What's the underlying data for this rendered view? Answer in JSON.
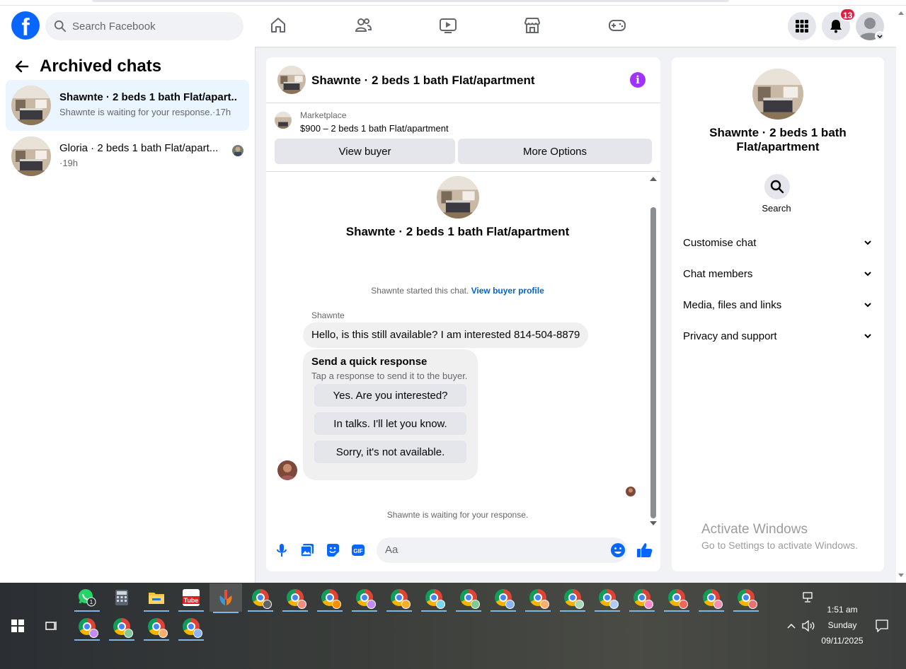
{
  "header": {
    "logo_letter": "f",
    "search_placeholder": "Search Facebook",
    "nav_icons": [
      "home-icon",
      "friends-icon",
      "video-icon",
      "marketplace-icon",
      "gaming-icon"
    ],
    "notification_count": "13"
  },
  "left": {
    "title": "Archived chats",
    "chats": [
      {
        "name": "Shawnte · 2 beds 1 bath Flat/apart...",
        "subtitle": "Shawnte is waiting for your response.·17h"
      },
      {
        "name": "Gloria · 2 beds 1 bath Flat/apart...",
        "subtitle": "·19h"
      }
    ]
  },
  "conversation": {
    "title": "Shawnte · 2 beds 1 bath Flat/apartment",
    "marketplace_label": "Marketplace",
    "listing": "$900 – 2 beds 1 bath Flat/apartment",
    "view_buyer": "View buyer",
    "more_options": "More Options",
    "center_title": "Shawnte · 2 beds 1 bath Flat/apartment",
    "started_text": "Shawnte started this chat.",
    "view_profile": "View buyer profile",
    "sender": "Shawnte",
    "message": "Hello, is this still available? I am interested 814-504-8879",
    "quick_title": "Send a quick response",
    "quick_sub": "Tap a response to send it to the buyer.",
    "quick_replies": [
      "Yes. Are you interested?",
      "In talks. I'll let you know.",
      "Sorry, it's not available."
    ],
    "waiting": "Shawnte is waiting for your response.",
    "composer_placeholder": "Aa"
  },
  "details": {
    "name": "Shawnte · 2 beds 1 bath Flat/apartment",
    "search_label": "Search",
    "sections": [
      "Customise chat",
      "Chat members",
      "Media, files and links",
      "Privacy and support"
    ]
  },
  "watermark": {
    "line1": "Activate Windows",
    "line2": "Go to Settings to activate Windows."
  },
  "taskbar": {
    "whatsapp_count": "1",
    "youtube_label": "Tube",
    "time": "1:51 am",
    "day": "Sunday",
    "date": "09/11/2025"
  },
  "colors": {
    "brand": "#0866ff",
    "accent_purple": "#a033ff",
    "badge": "#e41e3f",
    "active_chat_bg": "#ebf5ff"
  }
}
